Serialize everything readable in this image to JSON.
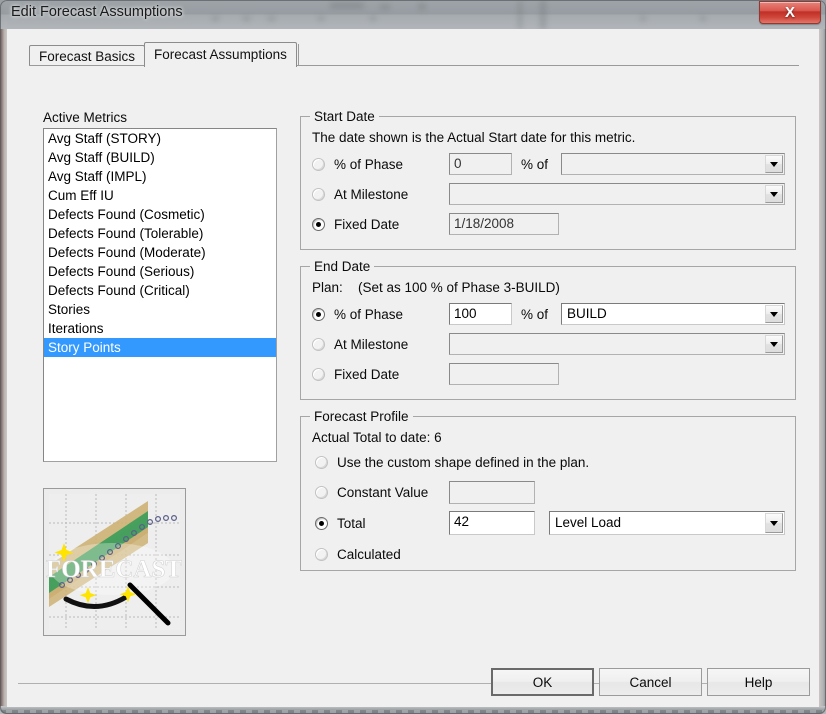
{
  "window": {
    "title": "Edit Forecast Assumptions",
    "close_label": "X"
  },
  "tabs": [
    {
      "label": "Forecast Basics",
      "active": false
    },
    {
      "label": "Forecast Assumptions",
      "active": true
    }
  ],
  "sidebar": {
    "list_label": "Active Metrics",
    "items": [
      {
        "label": "Avg Staff (STORY)",
        "selected": false
      },
      {
        "label": "Avg Staff (BUILD)",
        "selected": false
      },
      {
        "label": "Avg Staff (IMPL)",
        "selected": false
      },
      {
        "label": "Cum Eff IU",
        "selected": false
      },
      {
        "label": "Defects Found (Cosmetic)",
        "selected": false
      },
      {
        "label": "Defects Found (Tolerable)",
        "selected": false
      },
      {
        "label": "Defects Found (Moderate)",
        "selected": false
      },
      {
        "label": "Defects Found (Serious)",
        "selected": false
      },
      {
        "label": "Defects Found (Critical)",
        "selected": false
      },
      {
        "label": "Stories",
        "selected": false
      },
      {
        "label": "Iterations",
        "selected": false
      },
      {
        "label": "Story Points",
        "selected": true
      }
    ],
    "image_caption": "FORECAST"
  },
  "start_date": {
    "group_title": "Start Date",
    "description": "The date shown is the Actual Start date for this metric.",
    "pct_of_phase_label": "% of Phase",
    "pct_of_phase_value": "0",
    "pct_of_phase_selected": false,
    "pct_of_label": "% of",
    "phase_combo_value": "",
    "at_milestone_label": "At Milestone",
    "at_milestone_selected": false,
    "milestone_combo_value": "",
    "fixed_date_label": "Fixed Date",
    "fixed_date_selected": true,
    "fixed_date_value": "1/18/2008"
  },
  "end_date": {
    "group_title": "End Date",
    "plan_label": "Plan:",
    "plan_detail": "(Set as 100 % of Phase 3-BUILD)",
    "pct_of_phase_label": "% of Phase",
    "pct_of_phase_value": "100",
    "pct_of_phase_selected": true,
    "pct_of_label": "% of",
    "phase_combo_value": "BUILD",
    "at_milestone_label": "At Milestone",
    "at_milestone_selected": false,
    "milestone_combo_value": "",
    "fixed_date_label": "Fixed Date",
    "fixed_date_selected": false,
    "fixed_date_value": ""
  },
  "forecast_profile": {
    "group_title": "Forecast Profile",
    "actual_total_label": "Actual Total to date: 6",
    "custom_shape_label": "Use the custom shape defined in the plan.",
    "custom_shape_selected": false,
    "constant_value_label": "Constant Value",
    "constant_value_selected": false,
    "constant_value_value": "",
    "total_label": "Total",
    "total_selected": true,
    "total_value": "42",
    "shape_combo_value": "Level Load",
    "calculated_label": "Calculated",
    "calculated_selected": false
  },
  "footer": {
    "ok_label": "OK",
    "cancel_label": "Cancel",
    "help_label": "Help"
  },
  "colors": {
    "selection_blue": "#3399ff",
    "dialog_face": "#f0f0f0",
    "close_red": "#bf2f26"
  }
}
